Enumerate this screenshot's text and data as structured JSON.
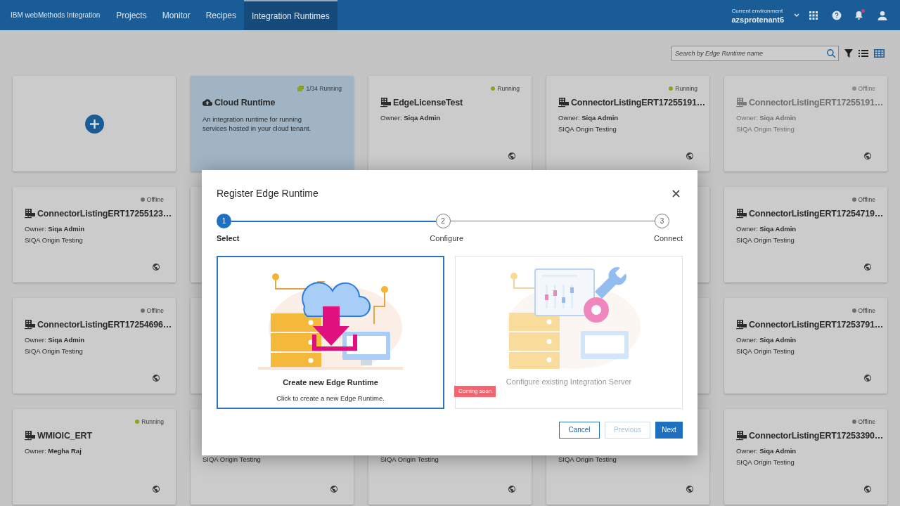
{
  "topbar": {
    "logo": "IBM webMethods Integration",
    "nav": [
      {
        "label": "Projects",
        "selected": false
      },
      {
        "label": "Monitor",
        "selected": false
      },
      {
        "label": "Recipes",
        "selected": false
      },
      {
        "label": "Integration Runtimes",
        "selected": true
      }
    ],
    "environment": {
      "label": "Current environment",
      "value": "azsprotenant6"
    },
    "notifications": {
      "unread": true
    }
  },
  "toolbar": {
    "search": {
      "placeholder": "Search by Edge Runtime name"
    },
    "views": [
      {
        "kind": "list",
        "selected": false
      },
      {
        "kind": "grid",
        "selected": true
      }
    ]
  },
  "cards": [
    {
      "kind": "add"
    },
    {
      "kind": "cloud",
      "status": "1/34 Running",
      "title": "Cloud Runtime",
      "description": "An integration runtime for running services hosted in your cloud tenant."
    },
    {
      "kind": "edge",
      "status": "Running",
      "color": "#8aa51e",
      "disabled": false,
      "title": "EdgeLicenseTest",
      "owner_label": "Owner:",
      "owner": "Siqa Admin"
    },
    {
      "kind": "edge",
      "status": "Running",
      "color": "#8aa51e",
      "disabled": false,
      "title": "ConnectorListingERT17255191…",
      "owner_label": "Owner:",
      "owner": "Siqa Admin",
      "description": "SIQA Origin Testing"
    },
    {
      "kind": "edge",
      "status": "Offline",
      "color": "#8c8c8c",
      "disabled": true,
      "title": "ConnectorListingERT17255191…",
      "owner_label": "Owner:",
      "owner": "Siqa Admin",
      "description": "SIQA Origin Testing"
    },
    {
      "kind": "edge",
      "status": "Offline",
      "color": "#6e6e6e",
      "disabled": false,
      "title": "ConnectorListingERT17255123…",
      "owner_label": "Owner:",
      "owner": "Siqa Admin",
      "description": "SIQA Origin Testing"
    },
    {
      "kind": "covered"
    },
    {
      "kind": "hidden"
    },
    {
      "kind": "covered"
    },
    {
      "kind": "edge",
      "status": "Offline",
      "color": "#6e6e6e",
      "disabled": false,
      "title": "ConnectorListingERT17254719…",
      "owner_label": "Owner:",
      "owner": "Siqa Admin",
      "description": "SIQA Origin Testing"
    },
    {
      "kind": "edge",
      "status": "Offline",
      "color": "#6e6e6e",
      "disabled": false,
      "title": "ConnectorListingERT17254696…",
      "owner_label": "Owner:",
      "owner": "Siqa Admin",
      "description": "SIQA Origin Testing"
    },
    {
      "kind": "covered"
    },
    {
      "kind": "hidden"
    },
    {
      "kind": "covered"
    },
    {
      "kind": "edge",
      "status": "Offline",
      "color": "#6e6e6e",
      "disabled": false,
      "title": "ConnectorListingERT17253791…",
      "owner_label": "Owner:",
      "owner": "Siqa Admin",
      "description": "SIQA Origin Testing"
    },
    {
      "kind": "edge",
      "status": "Running",
      "color": "#8aa51e",
      "disabled": false,
      "title": "WMIOIC_ERT",
      "owner_label": "Owner:",
      "owner": "Megha Raj"
    },
    {
      "kind": "covered",
      "description": "SIQA Origin Testing"
    },
    {
      "kind": "covered",
      "description": "SIQA Origin Testing"
    },
    {
      "kind": "covered",
      "description": "SIQA Origin Testing"
    },
    {
      "kind": "edge",
      "status": "Offline",
      "color": "#6e6e6e",
      "disabled": false,
      "title": "ConnectorListingERT17253390…",
      "owner_label": "Owner:",
      "owner": "Siqa Admin",
      "description": "SIQA Origin Testing"
    }
  ],
  "dialog": {
    "title": "Register Edge Runtime",
    "steps": [
      {
        "number": "1",
        "label": "Select",
        "selected": true
      },
      {
        "number": "2",
        "label": "Configure",
        "selected": false
      },
      {
        "number": "3",
        "label": "Connect",
        "selected": false
      }
    ],
    "options": [
      {
        "kind": "create",
        "title": "Create new Edge Runtime",
        "description": "Click to create a new Edge Runtime.",
        "selected": true,
        "disabled": false
      },
      {
        "kind": "configure",
        "title": "Configure existing Integration Server",
        "badge": "Coming soon",
        "selected": false,
        "disabled": true
      }
    ],
    "buttons": [
      {
        "kind": "secondary",
        "label": "Cancel",
        "disabled": false
      },
      {
        "kind": "secondary",
        "label": "Previous",
        "disabled": true
      },
      {
        "kind": "primary",
        "label": "Next",
        "disabled": false
      }
    ]
  }
}
